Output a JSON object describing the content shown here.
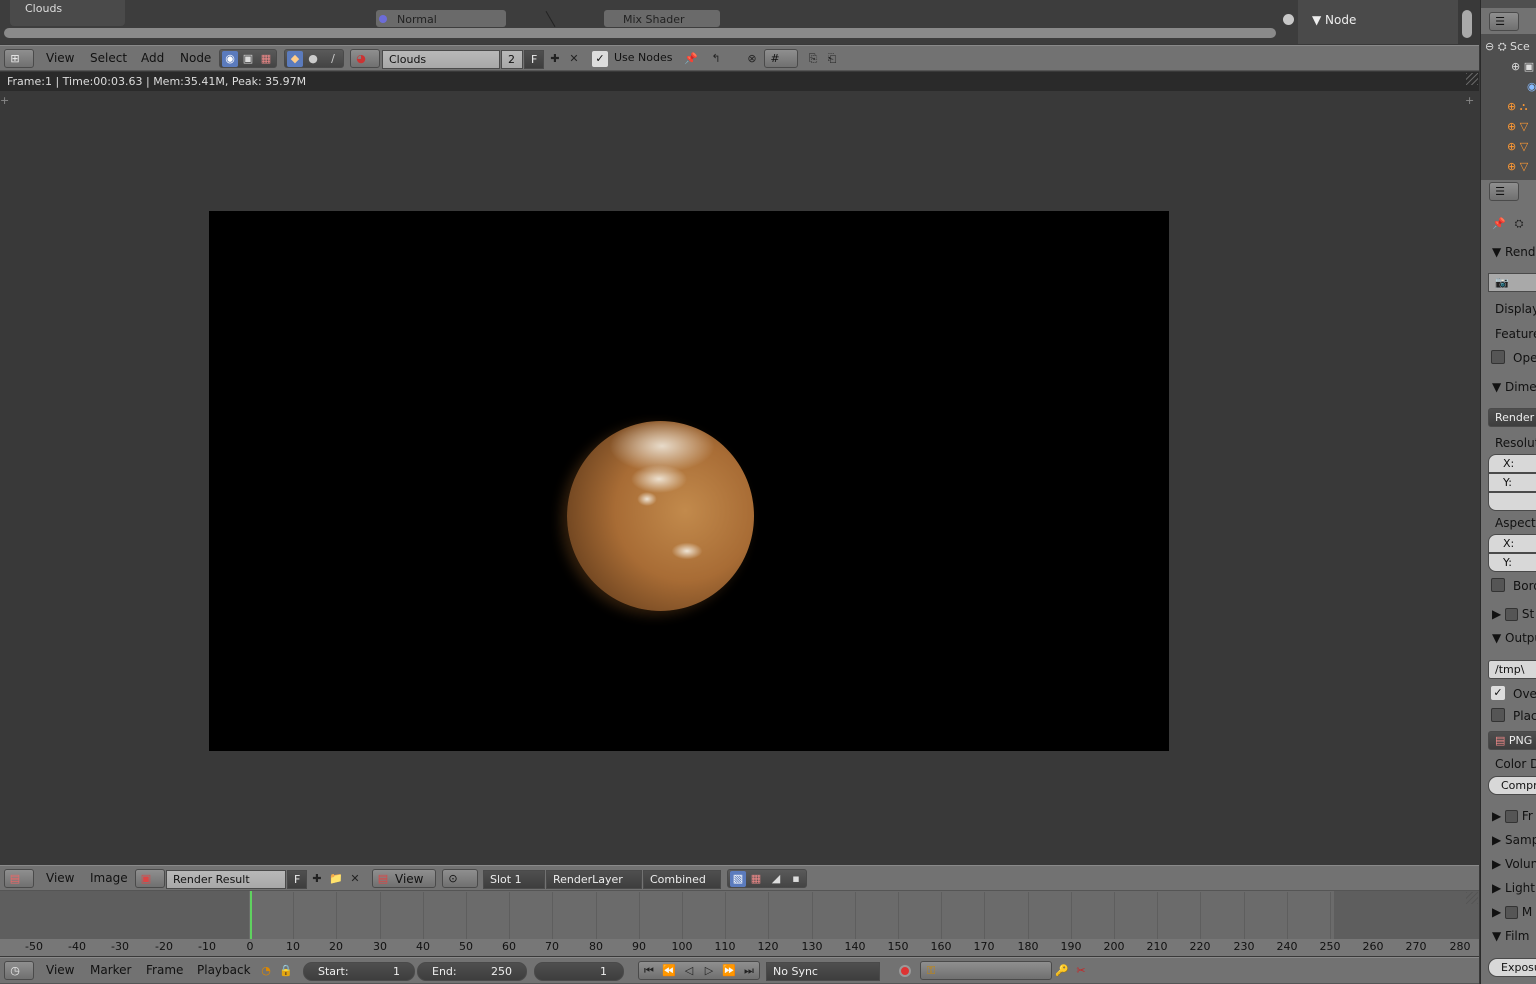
{
  "top_strip": {
    "tab_clouds": "Clouds",
    "node_normal": "Normal",
    "node_mix_shader": "Mix Shader",
    "panel_node_label": "Node"
  },
  "node_header": {
    "menus": [
      "View",
      "Select",
      "Add",
      "Node"
    ],
    "material_name": "Clouds",
    "user_count": "2",
    "fake_user": "F",
    "use_nodes_label": "Use Nodes",
    "use_nodes_checked": true
  },
  "image_info": {
    "render_stats": "Frame:1 | Time:00:03.63 | Mem:35.41M, Peak: 35.97M"
  },
  "image_header": {
    "menus": [
      "View",
      "Image"
    ],
    "image_name": "Render Result",
    "fake_user": "F",
    "view_label": "View",
    "slot": "Slot 1",
    "render_layer": "RenderLayer",
    "pass": "Combined"
  },
  "timeline": {
    "ruler": [
      "-50",
      "-40",
      "-30",
      "-20",
      "-10",
      "0",
      "10",
      "20",
      "30",
      "40",
      "50",
      "60",
      "70",
      "80",
      "90",
      "100",
      "110",
      "120",
      "130",
      "140",
      "150",
      "160",
      "170",
      "180",
      "190",
      "200",
      "210",
      "220",
      "230",
      "240",
      "250",
      "260",
      "270",
      "280"
    ],
    "current_frame": 1,
    "menus": [
      "View",
      "Marker",
      "Frame",
      "Playback"
    ],
    "start_label": "Start:",
    "start_value": "1",
    "end_label": "End:",
    "end_value": "250",
    "frame_value": "1",
    "sync": "No Sync"
  },
  "properties": {
    "render_header": "Rende",
    "display_label": "Display:",
    "feature_label": "Feature",
    "open_label": "Ope",
    "dimensions_header": "Dime",
    "render_preset": "Render P",
    "resolution_label": "Resolutio",
    "res_x": "X:",
    "res_y": "Y:",
    "aspect_label": "Aspect R",
    "asp_x": "X:",
    "asp_y": "Y:",
    "border_label": "Bord",
    "stamp_label": "St",
    "output_header": "Outpu",
    "output_path": "/tmp\\",
    "overwrite_label": "Over",
    "placeholder_label": "Plac",
    "format": "PNG",
    "color_depth_label": "Color De",
    "compression_label": "Compr",
    "freestyle_label": "Fr",
    "sampling_label": "Samp",
    "volume_label": "Volun",
    "light_label": "Light",
    "motion_label": "M",
    "film_label": "Film",
    "exposure_label": "Exposu"
  },
  "outliner": {
    "scene_label": "Sce"
  }
}
